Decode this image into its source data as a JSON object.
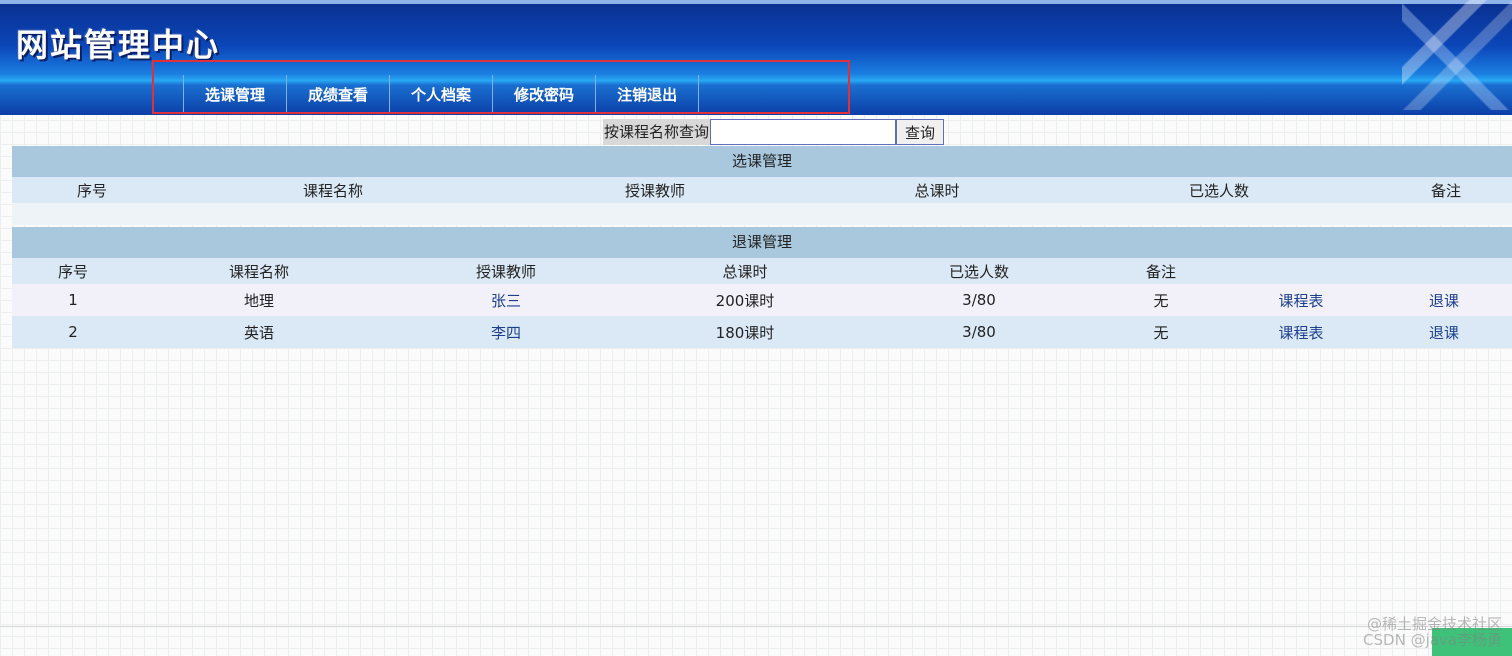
{
  "header": {
    "logo_text": "网站管理中心"
  },
  "nav": {
    "items": [
      {
        "label": "选课管理"
      },
      {
        "label": "成绩查看"
      },
      {
        "label": "个人档案"
      },
      {
        "label": "修改密码"
      },
      {
        "label": "注销退出"
      }
    ]
  },
  "search": {
    "label": "按课程名称查询",
    "value": "",
    "placeholder": "",
    "button_label": "查询"
  },
  "select_panel": {
    "title": "选课管理",
    "columns": [
      "序号",
      "课程名称",
      "授课教师",
      "总课时",
      "已选人数",
      "备注"
    ],
    "rows": []
  },
  "drop_panel": {
    "title": "退课管理",
    "columns": [
      "序号",
      "课程名称",
      "授课教师",
      "总课时",
      "已选人数",
      "备注"
    ],
    "rows": [
      {
        "index": "1",
        "course": "地理",
        "teacher": "张三",
        "hours": "200课时",
        "enrolled": "3/80",
        "note": "无",
        "schedule_link": "课程表",
        "drop_link": "退课"
      },
      {
        "index": "2",
        "course": "英语",
        "teacher": "李四",
        "hours": "180课时",
        "enrolled": "3/80",
        "note": "无",
        "schedule_link": "课程表",
        "drop_link": "退课"
      }
    ]
  },
  "watermark": {
    "line1": "@稀土掘金技术社区",
    "line2": "CSDN @java李杨勇"
  },
  "colors": {
    "header_dark": "#0a2f8e",
    "header_light": "#28a8f4",
    "panel_title_bg": "#a9c8de",
    "row_header_bg": "#dbe9f6",
    "link_color": "#1d3f8f",
    "highlight_border": "#e0303a"
  }
}
